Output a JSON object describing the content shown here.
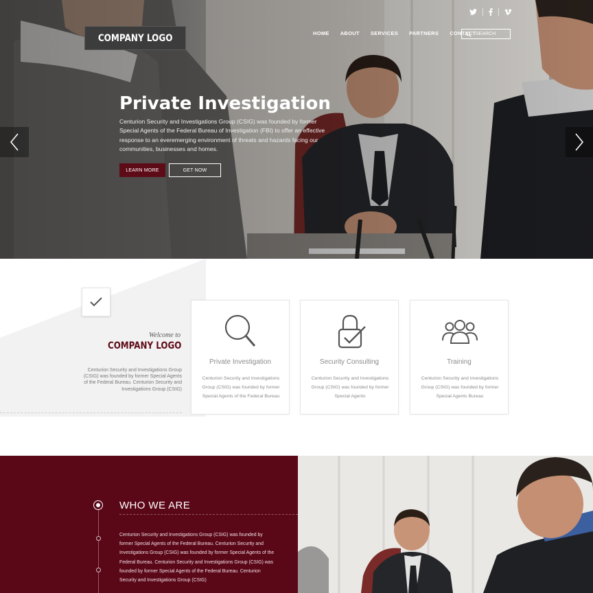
{
  "header": {
    "logo": "COMPANY LOGO",
    "social": [
      "twitter-icon",
      "facebook-icon",
      "vimeo-icon"
    ],
    "nav": [
      "HOME",
      "ABOUT",
      "SERVICES",
      "PARTNERS",
      "CONTACT"
    ],
    "search_placeholder": "SEARCH"
  },
  "hero": {
    "title": "Private Investigation",
    "text": "Centurion Security and Investigations Group (CSIG) was founded by former Special Agents of the Federal Bureau of Investigation (FBI) to offer an effective response to an everemerging environment of threats and hazards facing our communities, businesses and homes.",
    "learn_more": "LEARN MORE",
    "get_now": "GET NOW"
  },
  "welcome": {
    "small": "Welcome to",
    "logo": "COMPANY LOGO",
    "text": "Centurion Security and Investigations Group (CSIG) was founded by former Special Agents of the Federal Bureau. Centurion Security and Investigations Group (CSIG)"
  },
  "services": [
    {
      "icon": "magnifier-icon",
      "title": "Private Investigation",
      "text": "Centurion Security and Investigations Group (CSIG) was founded by former Special Agents of the Federal Bureau"
    },
    {
      "icon": "padlock-check-icon",
      "title": "Security Consulting",
      "text": "Centurion Security and Investigations Group (CSIG) was founded by former Special Agents"
    },
    {
      "icon": "group-users-icon",
      "title": "Training",
      "text": "Centurion Security and Investigations Group (CSIG) was founded by former Special Agents Bureau"
    }
  ],
  "who": {
    "title": "WHO WE ARE",
    "text": "Centurion Security and Investigations Group (CSIG) was founded by former Special Agents of the Federal Bureau. Centurion Security and Investigations Group (CSIG) was founded by former Special Agents of the Federal Bureau. Centurion Security and Investigations Group (CSIG) was founded by former Special Agents of the Federal Bureau. Centurion Security and Investigations Group (CSIG)"
  },
  "colors": {
    "brand": "#5e0b18",
    "who_bg": "#5a0718"
  }
}
